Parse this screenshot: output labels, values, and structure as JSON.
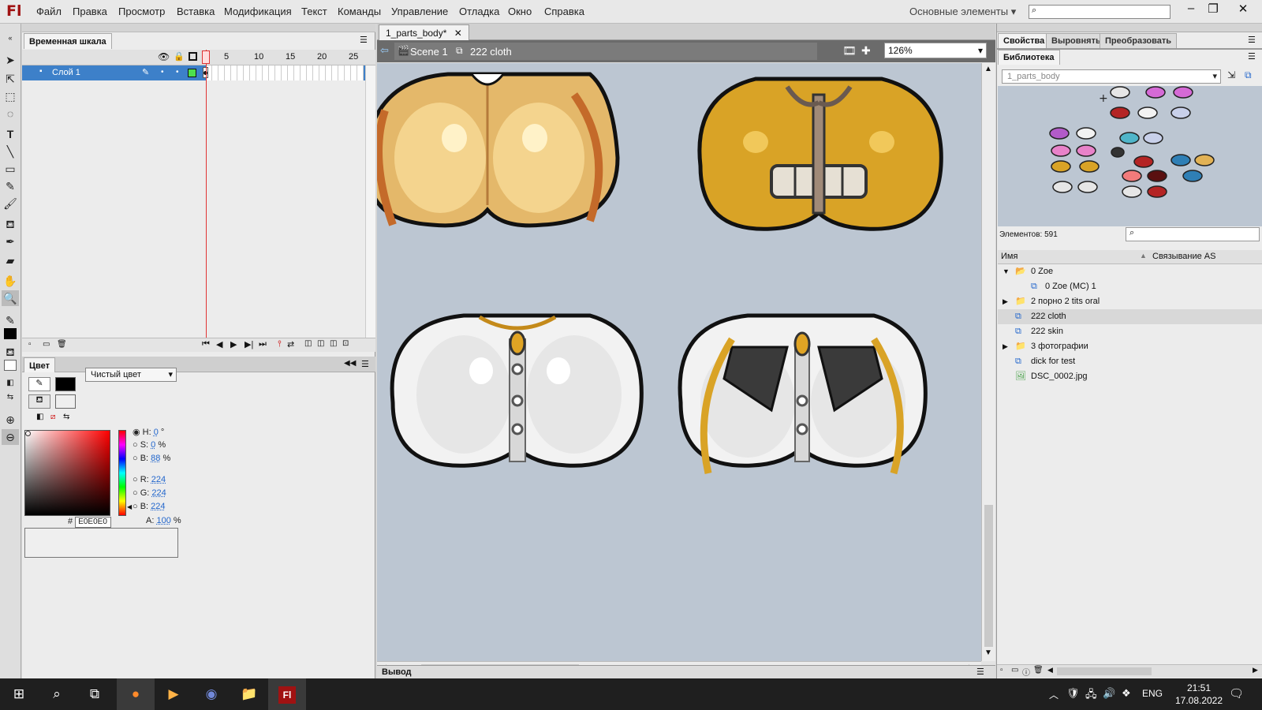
{
  "app": {
    "logo": "Fl"
  },
  "menu": [
    "Файл",
    "Правка",
    "Просмотр",
    "Вставка",
    "Модификация",
    "Текст",
    "Команды",
    "Управление",
    "Отладка",
    "Окно",
    "Справка"
  ],
  "workspace": "Основные элементы",
  "timeline": {
    "tab": "Временная шкала",
    "layer_name": "Слой 1",
    "frame_numbers": [
      "1",
      "5",
      "10",
      "15",
      "20",
      "25"
    ]
  },
  "color_panel": {
    "tab": "Цвет",
    "fill_type": "Чистый цвет",
    "h_label": "H:",
    "h": "0",
    "h_unit": "°",
    "s_label": "S:",
    "s": "0",
    "s_unit": "%",
    "b_label": "B:",
    "b": "88",
    "b_unit": "%",
    "r_label": "R:",
    "r": "224",
    "g_label": "G:",
    "g": "224",
    "bl_label": "B:",
    "bl": "224",
    "a_label": "A:",
    "a": "100",
    "a_unit": "%",
    "hex_label": "#",
    "hex": "E0E0E0"
  },
  "document": {
    "tab": "1_parts_body*",
    "scene": "Scene 1",
    "symbol": "222 cloth",
    "zoom": "126%"
  },
  "output_label": "Вывод",
  "right_panel": {
    "tabs": [
      "Свойства",
      "Выровнять",
      "Преобразовать"
    ],
    "library_tab": "Библиотека",
    "library_select": "1_parts_body",
    "items_count": "Элементов: 591",
    "col_name": "Имя",
    "col_linkage": "Связывание AS",
    "items": [
      {
        "label": "0 Zoe",
        "type": "folder-open"
      },
      {
        "label": "0 Zoe (MC) 1",
        "type": "symbol"
      },
      {
        "label": "2 порно 2 tits oral",
        "type": "folder"
      },
      {
        "label": "222 cloth",
        "type": "symbol"
      },
      {
        "label": "222 skin",
        "type": "symbol"
      },
      {
        "label": "3 фотографии",
        "type": "folder"
      },
      {
        "label": "dick for test",
        "type": "symbol"
      },
      {
        "label": "DSC_0002.jpg",
        "type": "bitmap"
      }
    ]
  },
  "taskbar": {
    "lang": "ENG",
    "time": "21:51",
    "date": "17.08.2022"
  },
  "colors": {
    "accent": "#3d80c9",
    "stage": "#bcc6d2",
    "gold": "#d9a326",
    "skin": "#e5c37c",
    "cloth": "#e6e6e6",
    "outline": "#111111"
  }
}
